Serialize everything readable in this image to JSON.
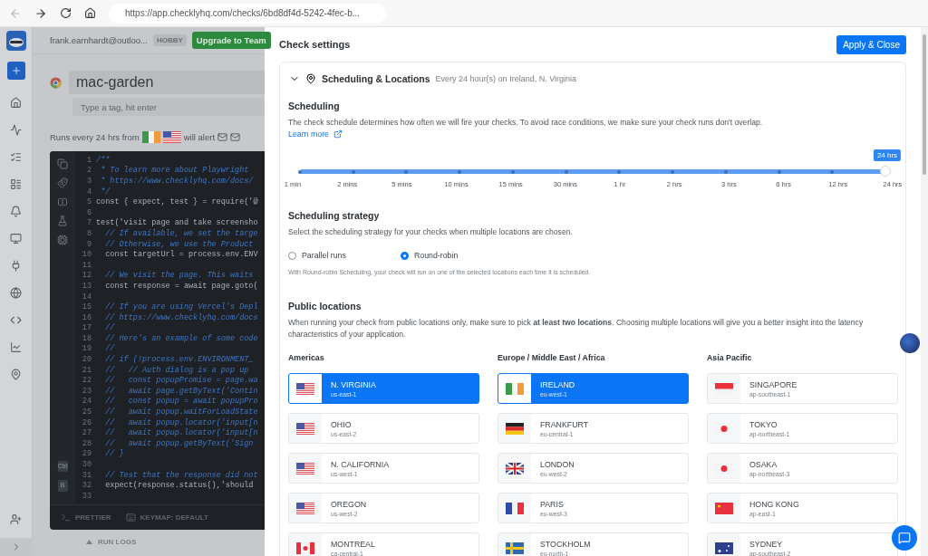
{
  "browser": {
    "url": "https://app.checklyhq.com/checks/6bd8df4d-5242-4fec-b..."
  },
  "header": {
    "user": "frank.earnhardt@outloo...",
    "plan": "HOBBY",
    "upgrade": "Upgrade to Team"
  },
  "check": {
    "name": "mac-garden",
    "tag_placeholder": "Type a tag, hit enter",
    "runs_text": "Runs every 24 hrs from",
    "alert_text": "will alert"
  },
  "editor": {
    "lines": [
      {
        "n": "1",
        "kind": "comment",
        "code": "/**"
      },
      {
        "n": "2",
        "kind": "comment",
        "code": " * To learn more about Playwright"
      },
      {
        "n": "3",
        "kind": "comment",
        "code": " * https://www.checklyhq.com/docs/"
      },
      {
        "n": "4",
        "kind": "comment",
        "code": " */"
      },
      {
        "n": "5",
        "kind": "code",
        "code": "const { expect, test } = require('@"
      },
      {
        "n": "6"
      },
      {
        "n": "7",
        "kind": "code",
        "code": "test('visit page and take screensho"
      },
      {
        "n": "8",
        "kind": "comment",
        "code": "  // If available, we set the targe"
      },
      {
        "n": "9",
        "kind": "comment",
        "code": "  // Otherwise, we use the Product"
      },
      {
        "n": "10",
        "kind": "code",
        "code": "  const targetUrl = process.env.ENV"
      },
      {
        "n": "11"
      },
      {
        "n": "12",
        "kind": "comment",
        "code": "  // We visit the page. This waits"
      },
      {
        "n": "13",
        "kind": "code",
        "code": "  const response = await page.goto("
      },
      {
        "n": "14"
      },
      {
        "n": "15",
        "kind": "comment",
        "code": "  // If you are using Vercel's Depl"
      },
      {
        "n": "16",
        "kind": "comment",
        "code": "  // https://www.checklyhq.com/docs"
      },
      {
        "n": "17",
        "kind": "comment",
        "code": "  //"
      },
      {
        "n": "18",
        "kind": "comment",
        "code": "  // Here's an example of some code"
      },
      {
        "n": "19",
        "kind": "comment",
        "code": "  //"
      },
      {
        "n": "20",
        "kind": "comment",
        "code": "  // if (!process.env.ENVIRONMENT_"
      },
      {
        "n": "21",
        "kind": "comment",
        "code": "  //   // Auth dialog is a pop up"
      },
      {
        "n": "22",
        "kind": "comment",
        "code": "  //   const popupPromise = page.wa"
      },
      {
        "n": "23",
        "kind": "comment",
        "code": "  //   await page.getByText('Contin"
      },
      {
        "n": "24",
        "kind": "comment",
        "code": "  //   const popup = await popupPro"
      },
      {
        "n": "25",
        "kind": "comment",
        "code": "  //   await popup.waitForLoadState"
      },
      {
        "n": "26",
        "kind": "comment",
        "code": "  //   await popup.locator('input[n"
      },
      {
        "n": "27",
        "kind": "comment",
        "code": "  //   await popup.locator('input[n"
      },
      {
        "n": "28",
        "kind": "comment",
        "code": "  //   await popup.getByText('Sign"
      },
      {
        "n": "29",
        "kind": "comment",
        "code": "  // }"
      },
      {
        "n": "30"
      },
      {
        "n": "31",
        "kind": "comment",
        "code": "  // Test that the response did not"
      },
      {
        "n": "32",
        "kind": "code",
        "code": "  expect(response.status(),'should"
      },
      {
        "n": "33"
      }
    ],
    "shortcut": "Ctrl",
    "shortcut_key": "B",
    "prettier": "PRETTIER",
    "keymap": "KEYMAP: DEFAULT"
  },
  "run_logs": "RUN LOGS",
  "drawer": {
    "title": "Check settings",
    "apply": "Apply & Close",
    "section": {
      "title": "Scheduling & Locations",
      "summary": "Every 24 hour(s) on Ireland, N. Virginia",
      "expanded": true
    },
    "scheduling": {
      "title": "Scheduling",
      "text": "The check schedule determines how often we will fire your checks. To avoid race conditions, we make sure your check runs don't overlap.",
      "link": "Learn more",
      "level": 1,
      "tooltip": "24 hrs",
      "ticks": [
        "1 min",
        "2 mins",
        "5 mins",
        "10 mins",
        "15 mins",
        "30 mins",
        "1 hr",
        "2 hrs",
        "3 hrs",
        "6 hrs",
        "12 hrs",
        "24 hrs"
      ]
    },
    "strategy": {
      "title": "Scheduling strategy",
      "text": "Select the scheduling strategy for your checks when multiple locations are chosen.",
      "options": [
        {
          "label": "Parallel runs",
          "selected": false
        },
        {
          "label": "Round-robin",
          "selected": true
        }
      ],
      "note": "With Round-robin Scheduling, your check will run on one of the selected locations each time it is scheduled."
    },
    "locations": {
      "title": "Public locations",
      "text": "When running your check from public locations only, make sure to pick **at least two locations**. Choosing multiple locations will give you a better insight into the latency characteristics of your application.",
      "regions": [
        {
          "name": "Americas",
          "items": [
            {
              "name": "N. VIRGINIA",
              "code": "us-east-1",
              "kind": "us",
              "selected": true
            },
            {
              "name": "OHIO",
              "code": "us-east-2",
              "kind": "us",
              "selected": false
            },
            {
              "name": "N. CALIFORNIA",
              "code": "us-west-1",
              "kind": "us",
              "selected": false
            },
            {
              "name": "OREGON",
              "code": "us-west-2",
              "kind": "us",
              "selected": false
            },
            {
              "name": "MONTREAL",
              "code": "ca-central-1",
              "kind": "ca",
              "selected": false
            }
          ]
        },
        {
          "name": "Europe / Middle East / Africa",
          "items": [
            {
              "name": "IRELAND",
              "code": "eu-west-1",
              "kind": "ie",
              "selected": true
            },
            {
              "name": "FRANKFURT",
              "code": "eu-central-1",
              "kind": "de",
              "selected": false
            },
            {
              "name": "LONDON",
              "code": "eu-west-2",
              "kind": "gb",
              "selected": false
            },
            {
              "name": "PARIS",
              "code": "eu-west-3",
              "kind": "fr",
              "selected": false
            },
            {
              "name": "STOCKHOLM",
              "code": "eu-north-1",
              "kind": "se",
              "selected": false
            }
          ]
        },
        {
          "name": "Asia Pacific",
          "items": [
            {
              "name": "SINGAPORE",
              "code": "ap-southeast-1",
              "kind": "sg",
              "selected": false
            },
            {
              "name": "TOKYO",
              "code": "ap-northeast-1",
              "kind": "jp",
              "selected": false
            },
            {
              "name": "OSAKA",
              "code": "ap-northeast-3",
              "kind": "jp",
              "selected": false
            },
            {
              "name": "HONG KONG",
              "code": "ap-east-1",
              "kind": "cn",
              "selected": false
            },
            {
              "name": "SYDNEY",
              "code": "ap-southeast-2",
              "kind": "au",
              "selected": false
            }
          ]
        }
      ]
    }
  }
}
